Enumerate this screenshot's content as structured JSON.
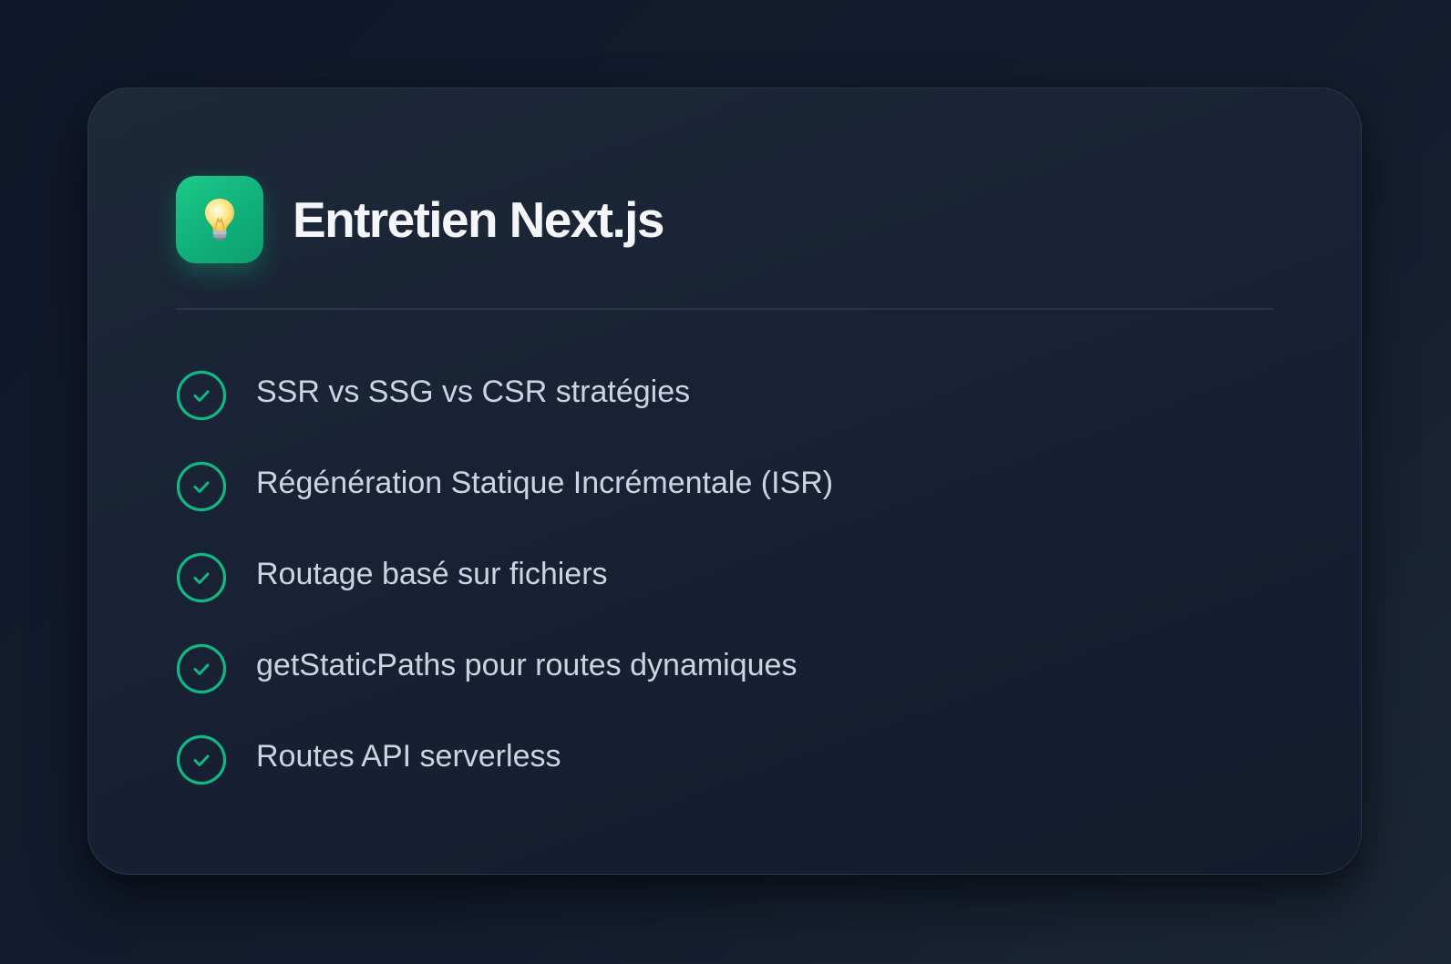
{
  "card": {
    "title": "Entretien Next.js",
    "icon": "lightbulb-icon",
    "items": [
      {
        "label": "SSR vs SSG vs CSR stratégies",
        "icon": "check-circle-icon"
      },
      {
        "label": "Régénération Statique Incrémentale (ISR)",
        "icon": "check-circle-icon"
      },
      {
        "label": "Routage basé sur fichiers",
        "icon": "check-circle-icon"
      },
      {
        "label": "getStaticPaths pour routes dynamiques",
        "icon": "check-circle-icon"
      },
      {
        "label": "Routes API serverless",
        "icon": "check-circle-icon"
      }
    ]
  },
  "colors": {
    "background": "#10172a",
    "card": "#1a2436",
    "accent": "#10b981",
    "title_text": "#f4f6fa",
    "item_text": "#cbd5e1"
  }
}
